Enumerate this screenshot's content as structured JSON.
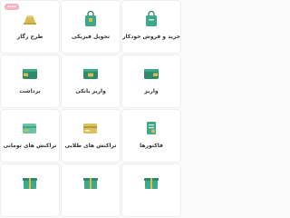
{
  "tiles": [
    {
      "label": "خرید و فروش خودکار",
      "icon": "bag-icon",
      "color": "#3ea88a",
      "badge": ""
    },
    {
      "label": "تحویل فیزیکی",
      "icon": "bag-icon",
      "color": "#3ea88a",
      "badge": ""
    },
    {
      "label": "طرح زگار",
      "icon": "gold-bar-icon",
      "color": "#d7bd54",
      "badge": "جدید"
    },
    {
      "label": "واریز",
      "icon": "wallet-icon",
      "color": "#2f8a6d",
      "badge": ""
    },
    {
      "label": "واریز بانکی",
      "icon": "wallet-icon",
      "color": "#2f8a6d",
      "badge": ""
    },
    {
      "label": "برداشت",
      "icon": "wallet-icon",
      "color": "#2f8a6d",
      "badge": ""
    },
    {
      "label": "فاکتورها",
      "icon": "invoice-icon",
      "color": "#3ea88a",
      "badge": ""
    },
    {
      "label": "تراکنش های طلایی",
      "icon": "gold-card-icon",
      "color": "#d9c15e",
      "badge": ""
    },
    {
      "label": "تراکنش های تومانی",
      "icon": "green-card-icon",
      "color": "#6fc3a0",
      "badge": ""
    },
    {
      "label": "",
      "icon": "gift-icon",
      "color": "#3ea88a",
      "badge": ""
    },
    {
      "label": "",
      "icon": "gift-icon",
      "color": "#3ea88a",
      "badge": ""
    },
    {
      "label": "",
      "icon": "gift-icon",
      "color": "#3ea88a",
      "badge": ""
    }
  ]
}
